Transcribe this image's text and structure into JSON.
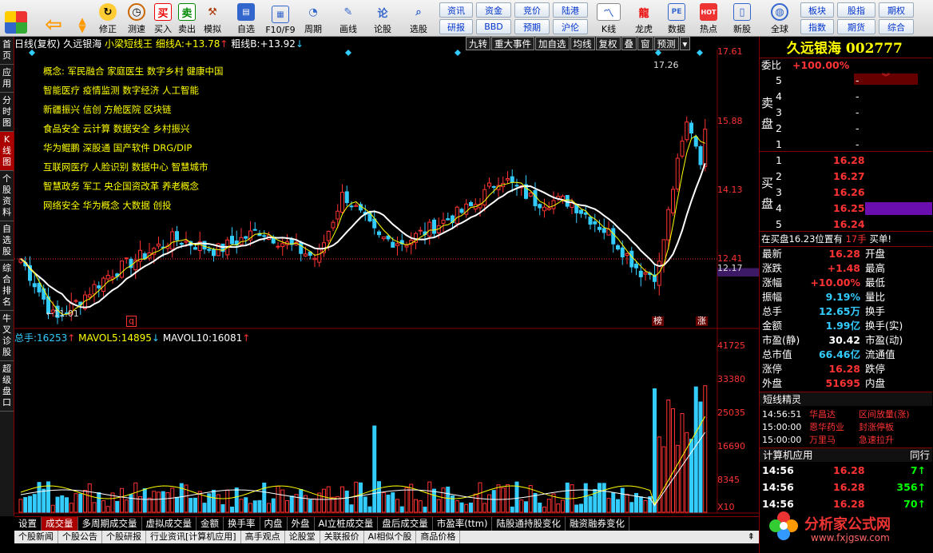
{
  "toolbar": {
    "left": [
      "修正",
      "测速",
      "买入",
      "卖出",
      "模拟",
      "自选",
      "F10/F9",
      "周期",
      "画线",
      "论股",
      "选股"
    ],
    "buy_icon": "买",
    "sell_icon": "卖",
    "grid1": [
      "资讯",
      "资金",
      "竞价",
      "陆港",
      "研报",
      "BBD",
      "预期",
      "沪伦"
    ],
    "right": [
      "K线",
      "龙虎",
      "数据",
      "热点",
      "新股",
      "全球"
    ],
    "right_icons": [
      "PE",
      "HOT"
    ],
    "grid2": [
      "板块",
      "股指",
      "期权",
      "指数",
      "期货",
      "综合"
    ]
  },
  "sidebar": [
    "首页",
    "应用",
    "分时图",
    "K线图",
    "个股资料",
    "自选股",
    "综合排名",
    "牛叉诊股",
    "超级盘口"
  ],
  "chart": {
    "header": {
      "period": "日线(复权)",
      "name": "久远银海",
      "ind": "小梁短线王",
      "lineA_label": "细线A:",
      "lineA": "+13.78",
      "lineB_label": "粗线B:",
      "lineB": "+13.92"
    },
    "topbtns": [
      "九转",
      "重大事件",
      "加自选",
      "均线",
      "复权",
      "叠",
      "窗",
      "预测"
    ],
    "axis": [
      "17.61",
      "15.88",
      "14.13",
      "12.41"
    ],
    "cur_price": "12.17",
    "high_label": "17.26",
    "low_label": "11.01",
    "marks": [
      "q",
      "榜",
      "涨"
    ],
    "concepts": [
      "概念: 军民融合 家庭医生 数字乡村 健康中国",
      "智能医疗 疫情监测 数字经济 人工智能",
      "新疆振兴 信创 方舱医院 区块链",
      "食品安全 云计算 数据安全 乡村振兴",
      "华为鲲鹏 深股通 国产软件 DRG/DIP",
      "互联网医疗 人脸识别 数据中心 智慧城市",
      "智慧政务 军工 央企国资改革 养老概念",
      "网络安全 华为概念 大数据 创投"
    ],
    "vol_header": {
      "t": "总手:",
      "v": "16253",
      "m5_label": "MAVOL5:",
      "m5": "14895",
      "m10_label": "MAVOL10:",
      "m10": "16081"
    },
    "vol_axis": [
      "41725",
      "33380",
      "25035",
      "16690",
      "8345",
      "X10"
    ]
  },
  "tabs": [
    "设置",
    "成交量",
    "多周期成交量",
    "虚拟成交量",
    "金额",
    "换手率",
    "内盘",
    "外盘",
    "AI立桩成交量",
    "盘后成交量",
    "市盈率(ttm)",
    "陆股通持股变化",
    "融资融券变化"
  ],
  "footer": [
    "个股新闻",
    "个股公告",
    "个股研报",
    "行业资讯[计算机应用]",
    "高手观点",
    "论股堂",
    "关联报价",
    "AI相似个股",
    "商品价格"
  ],
  "quote": {
    "title": "久远银海 002777",
    "weibi_label": "委比",
    "weibi": "+100.00%",
    "sell_label": [
      "卖",
      "盘"
    ],
    "buy_label": [
      "买",
      "盘"
    ],
    "asks": [
      [
        "5",
        "-"
      ],
      [
        "4",
        "-"
      ],
      [
        "3",
        "-"
      ],
      [
        "2",
        "-"
      ],
      [
        "1",
        "-"
      ]
    ],
    "bids": [
      [
        "1",
        "16.28"
      ],
      [
        "2",
        "16.27"
      ],
      [
        "3",
        "16.26"
      ],
      [
        "4",
        "16.25"
      ],
      [
        "5",
        "16.24"
      ]
    ],
    "notice_a": "在买盘16.23位置有",
    "notice_b": "17手",
    "notice_c": "买单!",
    "stats": [
      [
        "最新",
        "16.28",
        "开盘",
        ""
      ],
      [
        "涨跌",
        "+1.48",
        "最高",
        ""
      ],
      [
        "涨幅",
        "+10.00%",
        "最低",
        ""
      ],
      [
        "振幅",
        "9.19%",
        "量比",
        ""
      ],
      [
        "总手",
        "12.65万",
        "换手",
        ""
      ],
      [
        "金额",
        "1.99亿",
        "换手(实)",
        ""
      ],
      [
        "市盈(静)",
        "30.42",
        "市盈(动)",
        ""
      ],
      [
        "总市值",
        "66.46亿",
        "流通值",
        ""
      ],
      [
        "涨停",
        "16.28",
        "跌停",
        ""
      ],
      [
        "外盘",
        "51695",
        "内盘",
        ""
      ]
    ],
    "spirit_title": "短线精灵",
    "spirit": [
      [
        "14:56:51",
        "华昌达",
        "区间放量(涨)"
      ],
      [
        "15:00:00",
        "恩华药业",
        "封涨停板"
      ],
      [
        "15:00:00",
        "万里马",
        "急速拉升"
      ]
    ],
    "industry": "计算机应用",
    "industry_r": "同行",
    "ticks": [
      [
        "14:56",
        "16.28",
        "7"
      ],
      [
        "14:56",
        "16.28",
        "356"
      ],
      [
        "14:56",
        "16.28",
        "70"
      ]
    ],
    "watermark": "分析家公式网",
    "watermark_url": "www.fxjgsw.com"
  }
}
